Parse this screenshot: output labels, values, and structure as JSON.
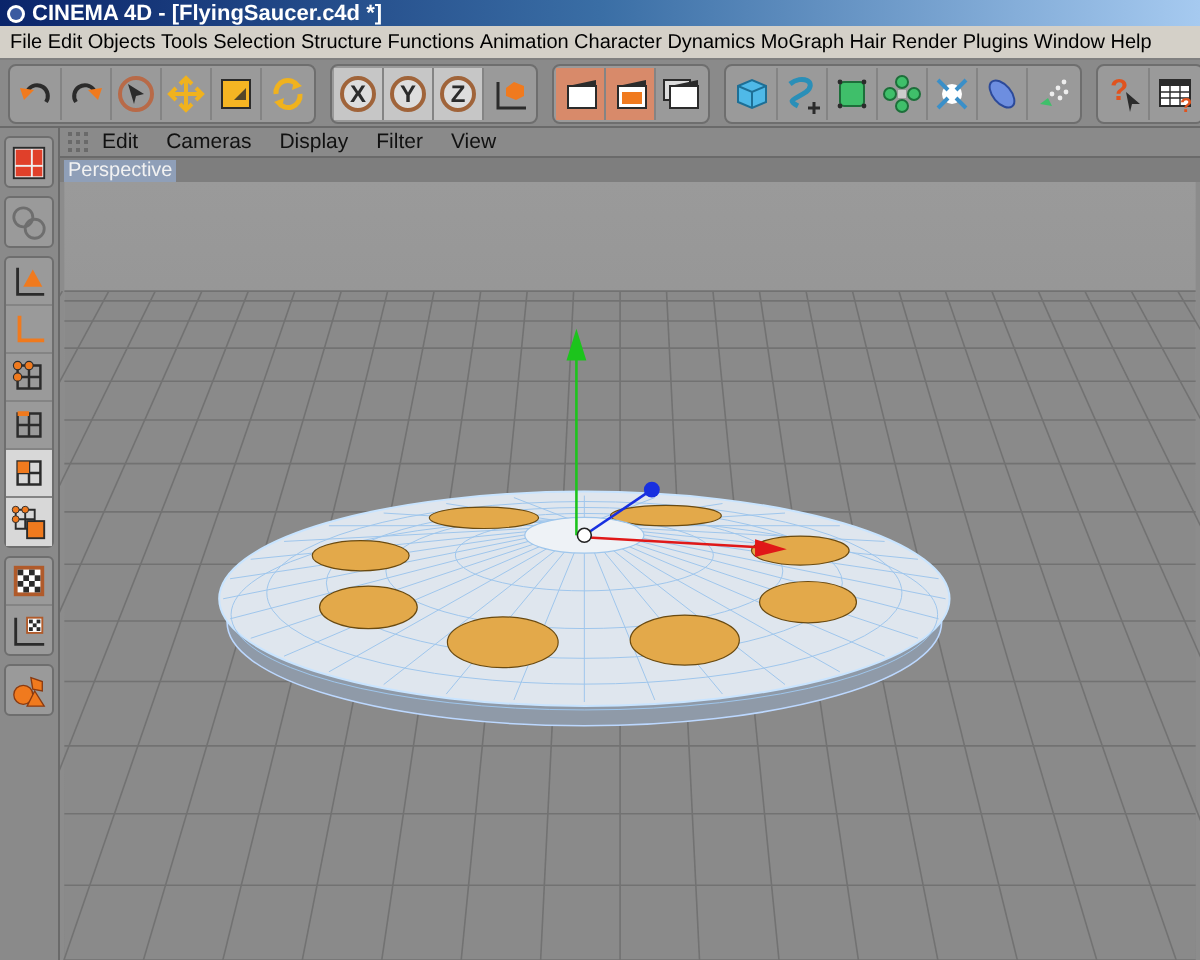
{
  "window": {
    "title": "CINEMA 4D - [FlyingSaucer.c4d *]"
  },
  "menu": [
    "File",
    "Edit",
    "Objects",
    "Tools",
    "Selection",
    "Structure",
    "Functions",
    "Animation",
    "Character",
    "Dynamics",
    "MoGraph",
    "Hair",
    "Render",
    "Plugins",
    "Window",
    "Help"
  ],
  "toolbar": [
    {
      "items": [
        {
          "kind": "undo",
          "selected": false
        },
        {
          "kind": "redo",
          "selected": false
        },
        {
          "kind": "select",
          "selected": false
        },
        {
          "kind": "move",
          "selected": false
        },
        {
          "kind": "scale",
          "selected": false
        },
        {
          "kind": "rotate",
          "selected": false
        }
      ]
    },
    {
      "items": [
        {
          "kind": "axis-letter",
          "label": "X",
          "selected": true
        },
        {
          "kind": "axis-letter",
          "label": "Y",
          "selected": true
        },
        {
          "kind": "axis-letter",
          "label": "Z",
          "selected": true
        },
        {
          "kind": "coordinates",
          "selected": false
        }
      ]
    },
    {
      "items": [
        {
          "kind": "clapper",
          "selected": true
        },
        {
          "kind": "clapper-window",
          "selected": true
        },
        {
          "kind": "clapper-stack",
          "selected": false
        }
      ]
    },
    {
      "items": [
        {
          "kind": "cube",
          "selected": false
        },
        {
          "kind": "spline",
          "selected": false
        },
        {
          "kind": "rounded-cube",
          "selected": false
        },
        {
          "kind": "flower",
          "selected": false
        },
        {
          "kind": "arrows-in",
          "selected": false
        },
        {
          "kind": "capsule",
          "selected": false
        },
        {
          "kind": "particles",
          "selected": false
        }
      ]
    },
    {
      "items": [
        {
          "kind": "help",
          "label": "?",
          "selected": false
        },
        {
          "kind": "table",
          "label": "?",
          "selected": false
        }
      ]
    }
  ],
  "sidebar": [
    {
      "group": [
        {
          "kind": "layout",
          "selected": false,
          "disabled": false
        }
      ]
    },
    {
      "group": [
        {
          "kind": "spheres",
          "selected": false,
          "disabled": true
        }
      ]
    },
    {
      "group": [
        {
          "kind": "object-axis",
          "selected": false,
          "disabled": false
        },
        {
          "kind": "axis",
          "selected": false,
          "disabled": false
        },
        {
          "kind": "points",
          "selected": false,
          "disabled": false
        },
        {
          "kind": "edges",
          "selected": false,
          "disabled": false
        },
        {
          "kind": "polygons",
          "selected": true,
          "disabled": false
        },
        {
          "kind": "uv",
          "selected": true,
          "disabled": false
        }
      ]
    },
    {
      "group": [
        {
          "kind": "texture",
          "selected": false,
          "disabled": false
        },
        {
          "kind": "texture-axis",
          "selected": false,
          "disabled": false
        }
      ]
    },
    {
      "group": [
        {
          "kind": "shapes",
          "selected": false,
          "disabled": false
        }
      ]
    }
  ],
  "viewport": {
    "menu": [
      "Edit",
      "Cameras",
      "Display",
      "Filter",
      "View"
    ],
    "camera": "Perspective"
  }
}
